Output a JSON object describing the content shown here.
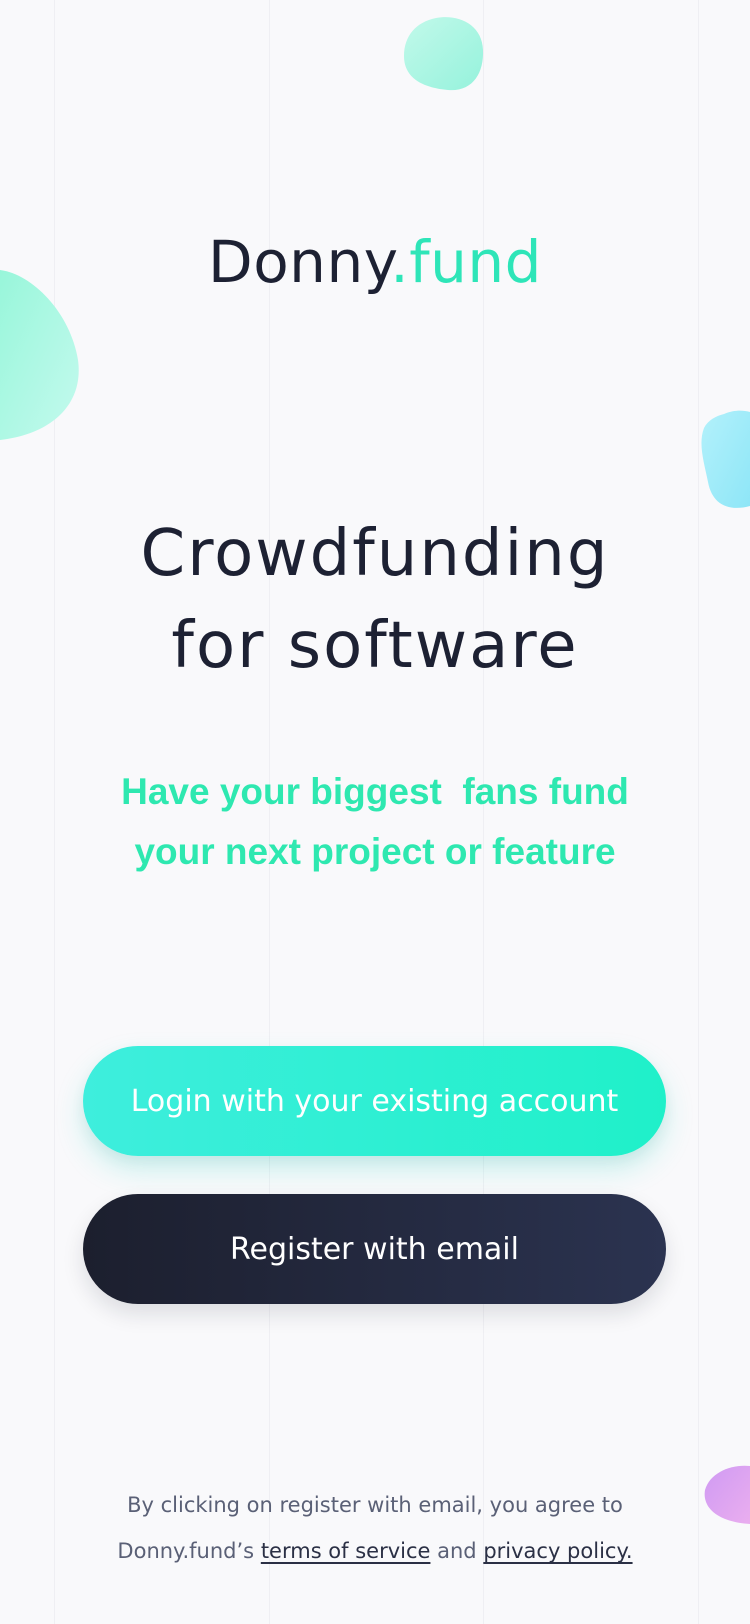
{
  "brand": {
    "name_main": "Donny",
    "name_accent": ".fund"
  },
  "hero": {
    "headline_line1": "Crowdfunding",
    "headline_line2": "for software",
    "tagline_line1": "Have your biggest  fans fund",
    "tagline_line2": "your next project or feature"
  },
  "actions": {
    "login_label": "Login with your existing account",
    "register_label": "Register with email"
  },
  "legal": {
    "line1": "By clicking on register with email, you agree to",
    "line2_prefix": "Donny.fund’s ",
    "terms_link": "terms of service",
    "conjunction": " and ",
    "privacy_link": "privacy policy."
  },
  "colors": {
    "background": "#f9f9fb",
    "text_dark": "#1d2133",
    "accent_green": "#2ee8b0",
    "login_gradient_start": "#3eeedd",
    "login_gradient_end": "#1ff0c9",
    "register_gradient_start": "#1c1f2e",
    "register_gradient_end": "#2b3350",
    "blob_cyan": "#a6ecf9",
    "blob_purple": "#dd9cf3"
  }
}
